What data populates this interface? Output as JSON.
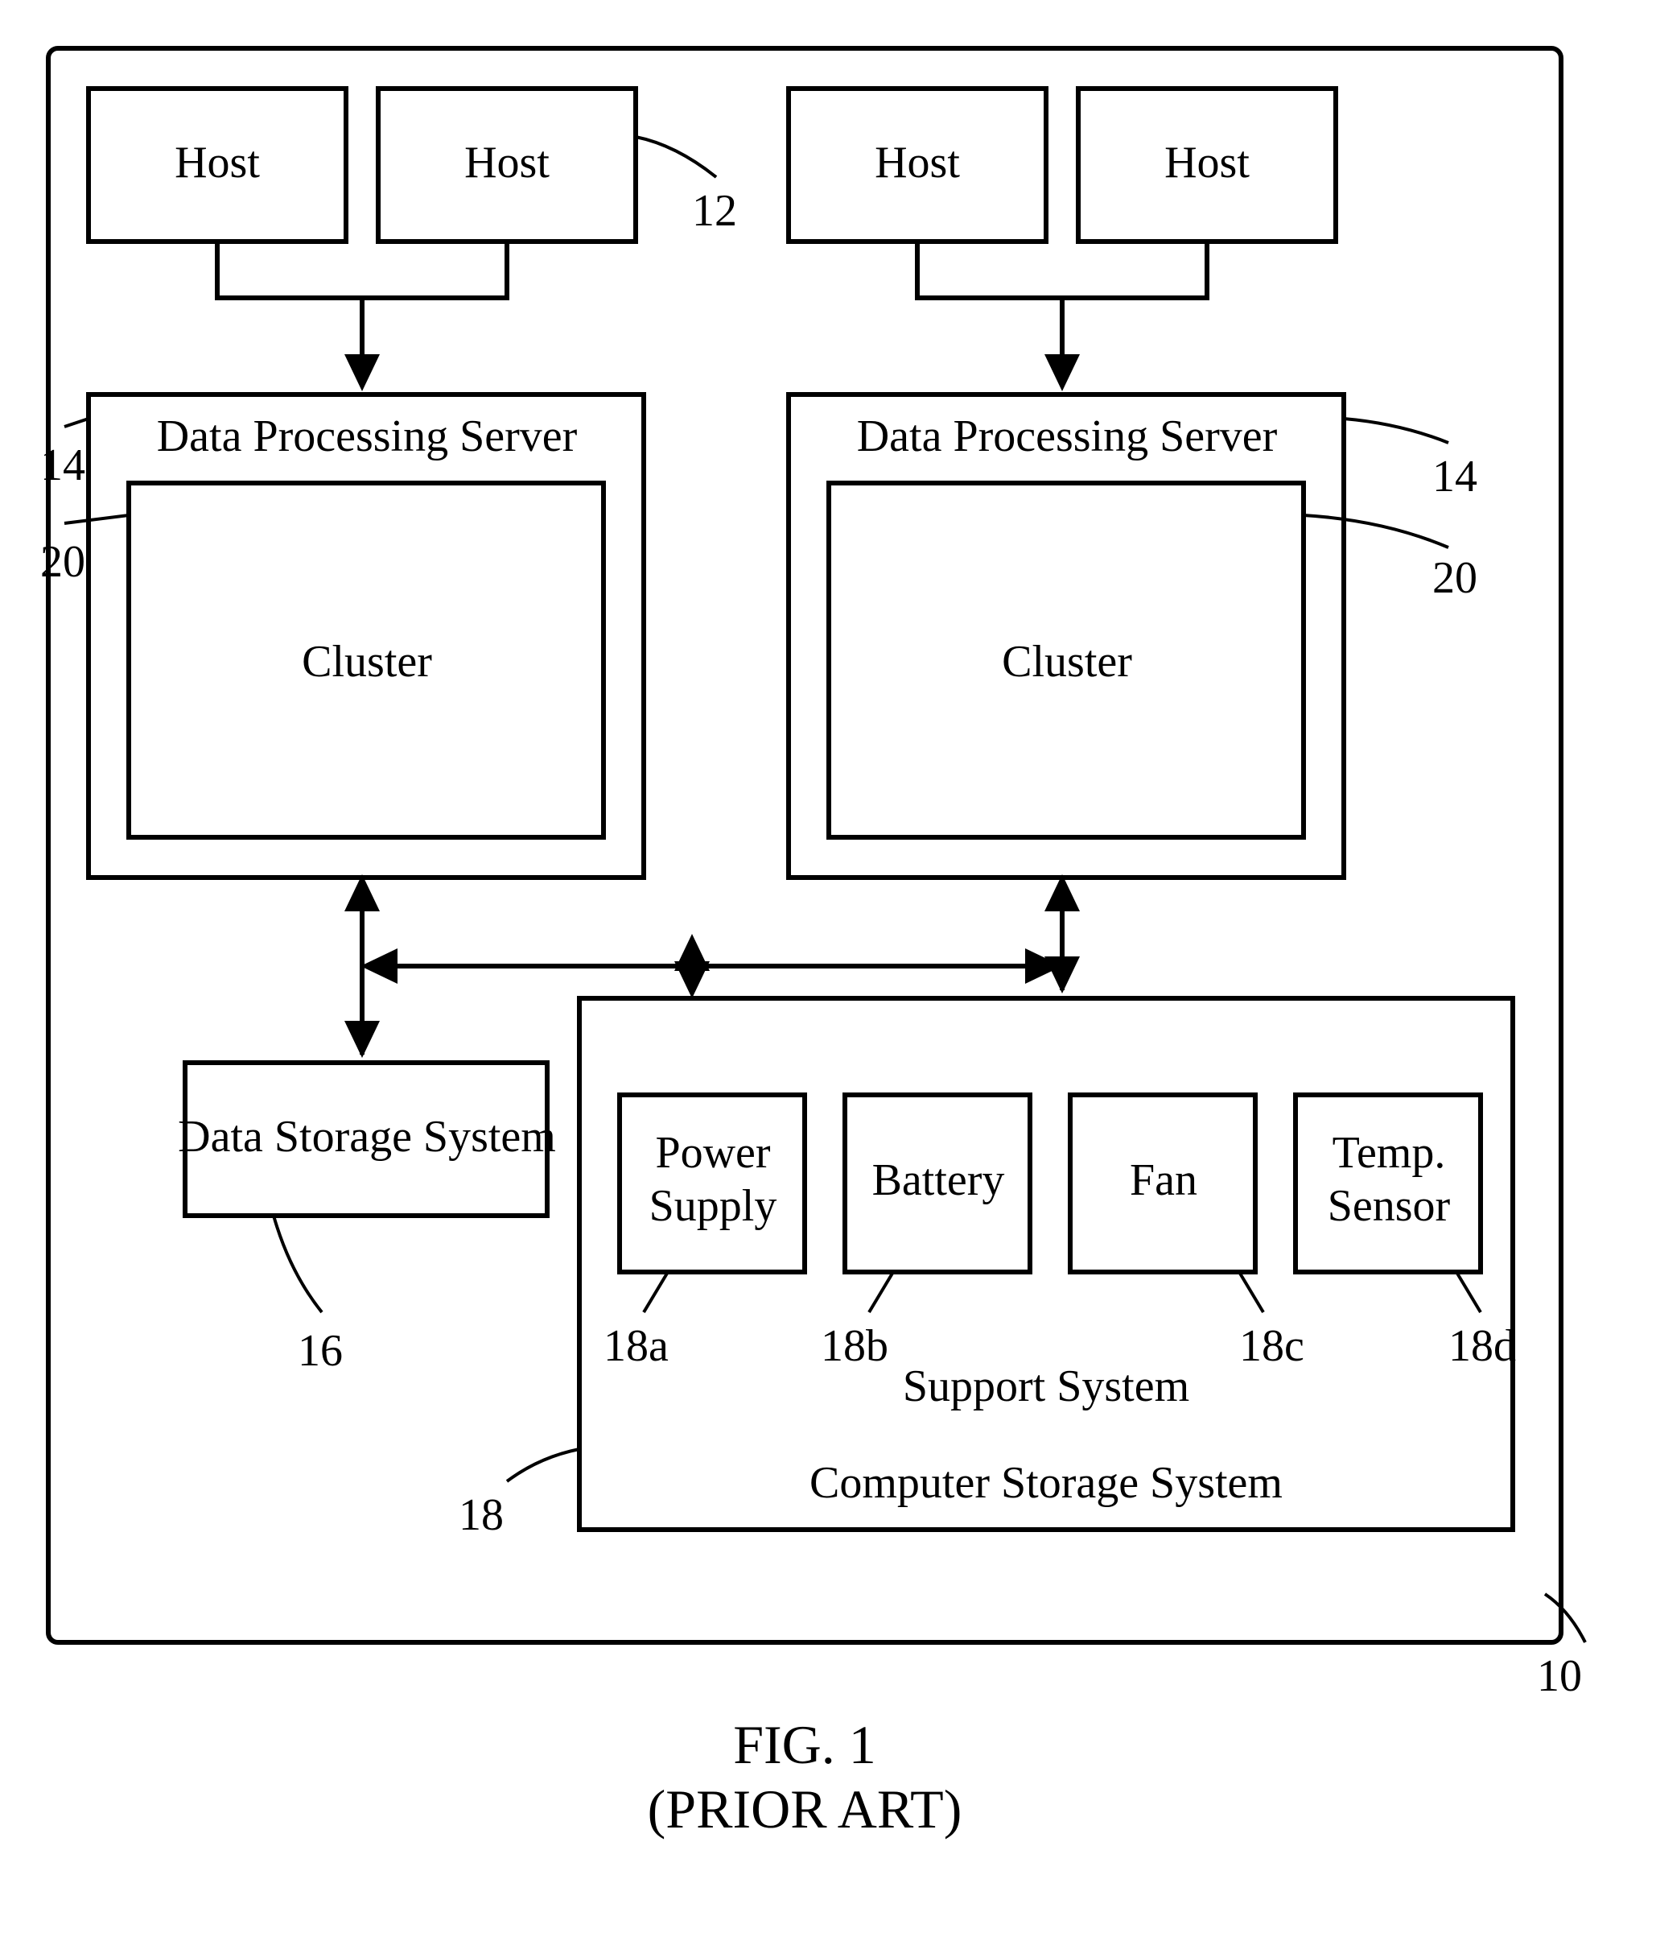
{
  "figure": {
    "title_line1": "FIG. 1",
    "title_line2": "(PRIOR ART)",
    "outer": "Computer Storage System",
    "hosts": [
      "Host",
      "Host",
      "Host",
      "Host"
    ],
    "host_id": "12",
    "dps": {
      "label": "Data Processing Server",
      "cluster": "Cluster",
      "id_left_dps": "14",
      "id_left_cluster": "20",
      "id_right_dps": "14",
      "id_right_cluster": "20"
    },
    "dss": {
      "label": "Data Storage System",
      "id": "16"
    },
    "support": {
      "label": "Support System",
      "id": "18",
      "items": [
        {
          "line1": "Power",
          "line2": "Supply",
          "id": "18a"
        },
        {
          "line1": "Battery",
          "line2": "",
          "id": "18b"
        },
        {
          "line1": "Fan",
          "line2": "",
          "id": "18c"
        },
        {
          "line1": "Temp.",
          "line2": "Sensor",
          "id": "18d"
        }
      ]
    },
    "outer_id": "10"
  }
}
